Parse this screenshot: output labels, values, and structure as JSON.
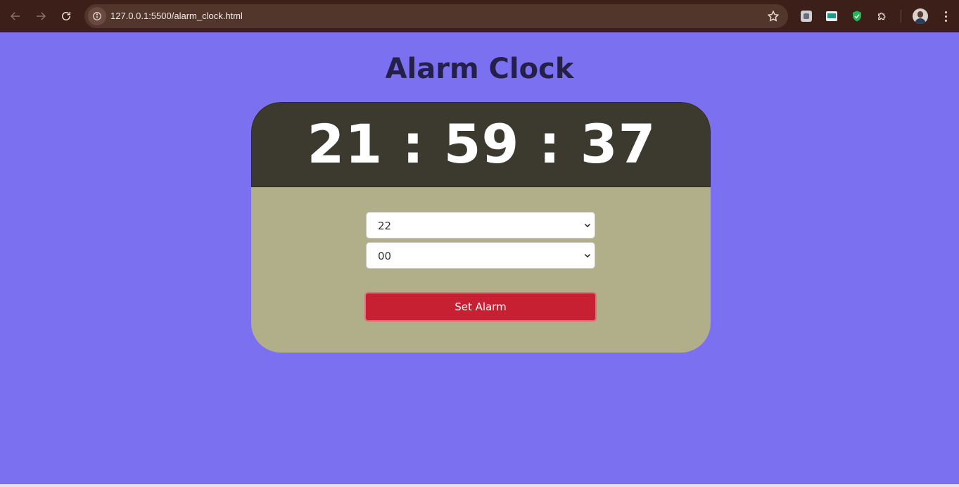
{
  "browser": {
    "url": "127.0.0.1:5500/alarm_clock.html",
    "icons": {
      "back": "arrow-left-icon",
      "forward": "arrow-right-icon",
      "reload": "reload-icon",
      "site_info": "info-icon",
      "bookmark": "star-icon",
      "extensions": "puzzle-icon",
      "menu": "kebab-menu-icon"
    }
  },
  "page": {
    "title": "Alarm Clock",
    "background": "#7b70f0"
  },
  "clock": {
    "time": "21 : 59 : 37",
    "hours": "21",
    "minutes": "59",
    "seconds": "37"
  },
  "alarm": {
    "hour_selected": "22",
    "minute_selected": "00",
    "set_label": "Set Alarm",
    "button_color": "#c82033"
  }
}
